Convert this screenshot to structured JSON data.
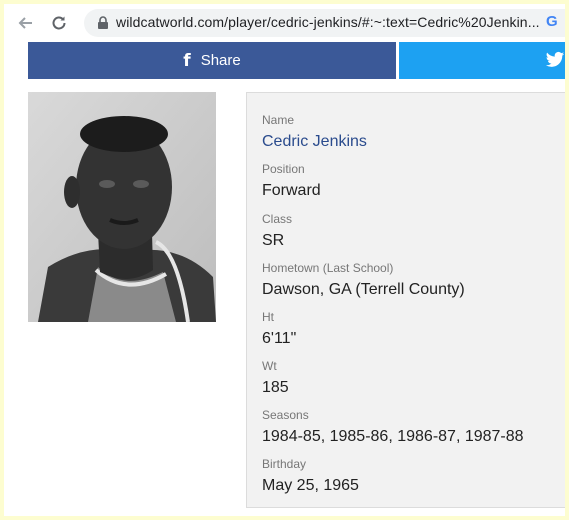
{
  "browser": {
    "url": "wildcatworld.com/player/cedric-jenkins/#:~:text=Cedric%20Jenkin..."
  },
  "share": {
    "facebook_label": "Share"
  },
  "player": {
    "fields": [
      {
        "label": "Name",
        "value": "Cedric Jenkins"
      },
      {
        "label": "Position",
        "value": "Forward"
      },
      {
        "label": "Class",
        "value": "SR"
      },
      {
        "label": "Hometown (Last School)",
        "value": "Dawson, GA (Terrell County)"
      },
      {
        "label": "Ht",
        "value": "6'11\""
      },
      {
        "label": "Wt",
        "value": "185"
      },
      {
        "label": "Seasons",
        "value": "1984-85, 1985-86, 1986-87, 1987-88"
      },
      {
        "label": "Birthday",
        "value": "May 25, 1965"
      }
    ]
  },
  "colors": {
    "facebook": "#3b5998",
    "twitter": "#1da1f2",
    "name_link": "#2a4b8d",
    "page_border": "#fdfdd0"
  },
  "icons": [
    "back-arrow-icon",
    "reload-icon",
    "lock-icon",
    "google-icon",
    "facebook-icon",
    "twitter-icon"
  ]
}
